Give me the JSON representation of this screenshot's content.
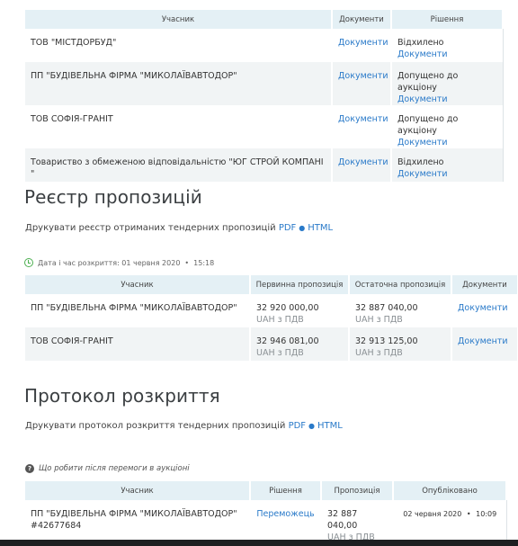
{
  "bidders": {
    "headers": [
      "Учасник",
      "Документи",
      "Рішення"
    ],
    "rows": [
      {
        "name": "ТОВ \"МІСТДОРБУД\"",
        "docs": "Документи",
        "decision": "Відхилено",
        "decision_docs": "Документи"
      },
      {
        "name": "ПП \"БУДІВЕЛЬНА ФІРМА \"МИКОЛАЇВАВТОДОР\"",
        "docs": "Документи",
        "decision": "Допущено до аукціону",
        "decision_docs": "Документи"
      },
      {
        "name": "ТОВ СОФІЯ-ГРАНІТ",
        "docs": "Документи",
        "decision": "Допущено до аукціону",
        "decision_docs": "Документи"
      },
      {
        "name": "Товариство з обмеженою відповідальністю \"ЮГ СТРОЙ КОМПАНІ \"",
        "docs": "Документи",
        "decision": "Відхилено",
        "decision_docs": "Документи"
      }
    ]
  },
  "register": {
    "title": "Реєстр пропозицій",
    "print_text": "Друкувати реєстр отриманих тендерних пропозицій",
    "pdf": "PDF",
    "sep": "●",
    "html": "HTML",
    "opened": "Дата і час розкриття: 01 червня 2020",
    "opened_sep": "•",
    "opened_time": "15:18",
    "headers": [
      "Учасник",
      "Первинна пропозиція",
      "Остаточна пропозиція",
      "Документи"
    ],
    "rows": [
      {
        "name": "ПП \"БУДІВЕЛЬНА ФІРМА \"МИКОЛАЇВАВТОДОР\"",
        "initial": "32 920 000,00",
        "initial_vat": "UAH з ПДВ",
        "final": "32 887 040,00",
        "final_vat": "UAH з ПДВ",
        "docs": "Документи"
      },
      {
        "name": "ТОВ СОФІЯ-ГРАНІТ",
        "initial": "32 946 081,00",
        "initial_vat": "UAH з ПДВ",
        "final": "32 913 125,00",
        "final_vat": "UAH з ПДВ",
        "docs": "Документи"
      }
    ]
  },
  "protocol": {
    "title": "Протокол розкриття",
    "print_text": "Друкувати протокол розкриття тендерних пропозицій",
    "pdf": "PDF",
    "sep": "●",
    "html": "HTML",
    "help": "Що робити після перемоги в аукціоні",
    "headers": [
      "Учасник",
      "Рішення",
      "Пропозиція",
      "Опубліковано"
    ],
    "row": {
      "name": "ПП \"БУДІВЕЛЬНА ФІРМА \"МИКОЛАЇВАВТОДОР\"",
      "id": "#42677684",
      "decision": "Переможець",
      "offer": "32 887 040,00",
      "offer_vat": "UAH з ПДВ",
      "date": "02 червня 2020",
      "date_sep": "•",
      "time": "10:09"
    }
  },
  "colors": {
    "link": "#2a7ac9",
    "header_bg": "#e4f0f5",
    "clock": "#4caf50"
  }
}
